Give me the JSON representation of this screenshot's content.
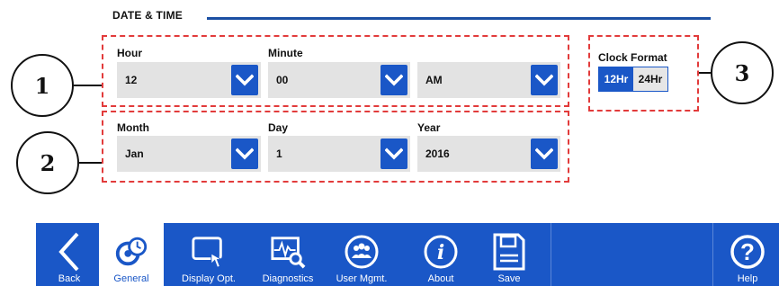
{
  "section": {
    "title": "DATE & TIME"
  },
  "callouts": [
    "1",
    "2",
    "3"
  ],
  "time": {
    "hour": {
      "label": "Hour",
      "value": "12"
    },
    "minute": {
      "label": "Minute",
      "value": "00"
    },
    "ampm": {
      "value": "AM"
    }
  },
  "date": {
    "month": {
      "label": "Month",
      "value": "Jan"
    },
    "day": {
      "label": "Day",
      "value": "1"
    },
    "year": {
      "label": "Year",
      "value": "2016"
    }
  },
  "clock_format": {
    "label": "Clock Format",
    "options": [
      "12Hr",
      "24Hr"
    ],
    "selected": "12Hr"
  },
  "nav": {
    "back": "Back",
    "general": "General",
    "display": "Display Opt.",
    "diagnostics": "Diagnostics",
    "users": "User Mgmt.",
    "about": "About",
    "save": "Save",
    "help": "Help",
    "active": "General"
  },
  "colors": {
    "accent": "#1a57c7",
    "callout_box": "#e23b3b",
    "header_line": "#1b4fa3"
  }
}
